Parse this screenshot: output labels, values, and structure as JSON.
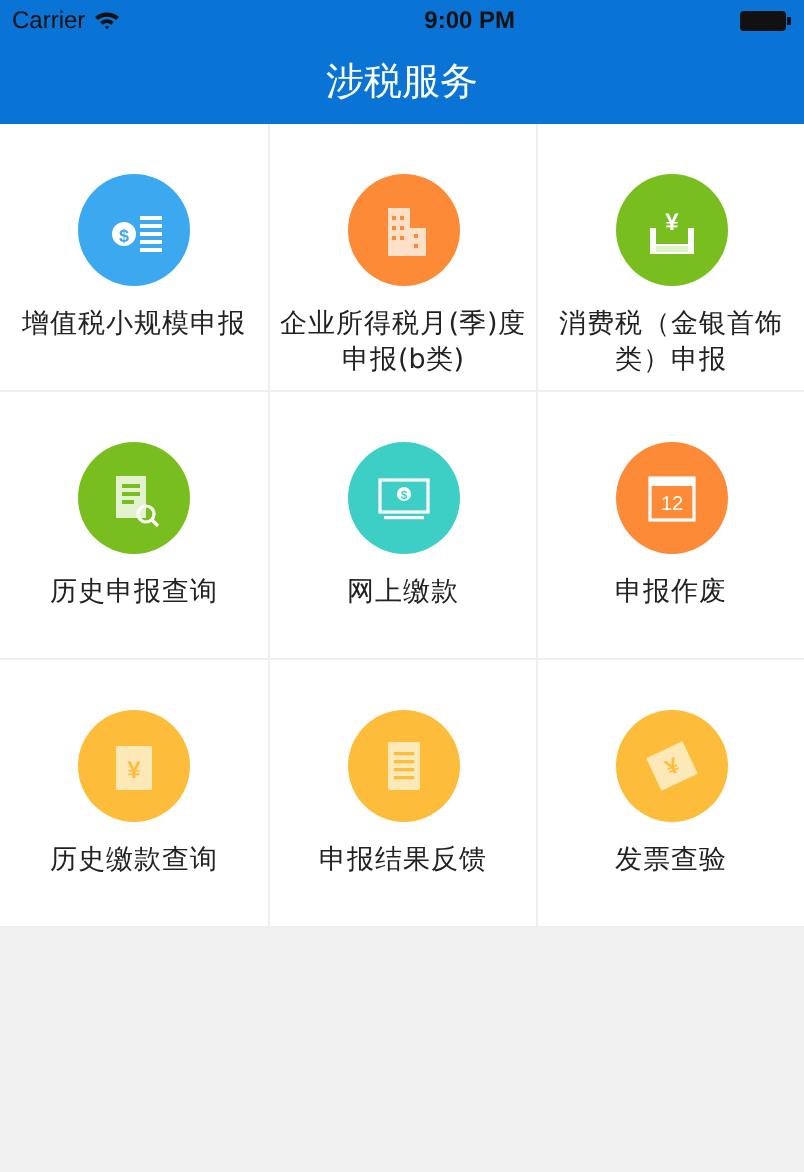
{
  "status_bar": {
    "carrier": "Carrier",
    "time": "9:00 PM"
  },
  "nav_bar": {
    "title": "涉税服务"
  },
  "services": [
    {
      "label": "增值税小规模申报",
      "kind": "coins",
      "glyph": "$",
      "color": "#3ba8ef"
    },
    {
      "label": "企业所得税月(季)度申报(b类)",
      "kind": "building",
      "color": "#fd8a36"
    },
    {
      "label": "消费税（金银首饰类）申报",
      "kind": "tray",
      "glyph": "¥",
      "color": "#78be1e"
    },
    {
      "label": "历史申报查询",
      "kind": "document",
      "color": "#78be1e"
    },
    {
      "label": "网上缴款",
      "kind": "monitor",
      "glyph": "$",
      "color": "#3dcfc6"
    },
    {
      "label": "申报作废",
      "kind": "calendar",
      "glyph": "12",
      "color": "#fd8a36"
    },
    {
      "label": "历史缴款查询",
      "kind": "wallet",
      "glyph": "¥",
      "color": "#fdbd3b"
    },
    {
      "label": "申报结果反馈",
      "kind": "list",
      "color": "#fdbd3b"
    },
    {
      "label": "发票查验",
      "kind": "ticket",
      "glyph": "¥",
      "color": "#fdbd3b"
    }
  ]
}
